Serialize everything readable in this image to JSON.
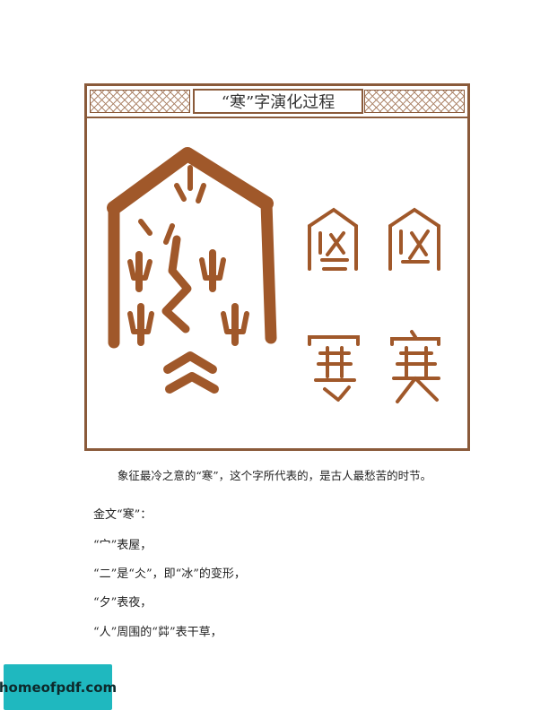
{
  "figure": {
    "title": "“寒”字演化过程",
    "glyphs": {
      "small_seal_1": "寒",
      "small_seal_2": "寒",
      "clerical": "寒",
      "regular": "寒"
    }
  },
  "text": {
    "caption": "象征最冷之意的“寒”，这个字所代表的，是古人最愁苦的时节。",
    "line1": "金文“寒”：",
    "line2": "“宀”表屋，",
    "line3": "“二”是“仌”，即“冰”的变形，",
    "line4": "“夕”表夜，",
    "line5": "“人”周围的“茻”表干草，"
  },
  "watermark": {
    "text": "homeofpdf.com"
  },
  "colors": {
    "brown": "#8a5a3a",
    "glyph": "#a0582a",
    "watermark_bg": "#1fb8bf"
  }
}
